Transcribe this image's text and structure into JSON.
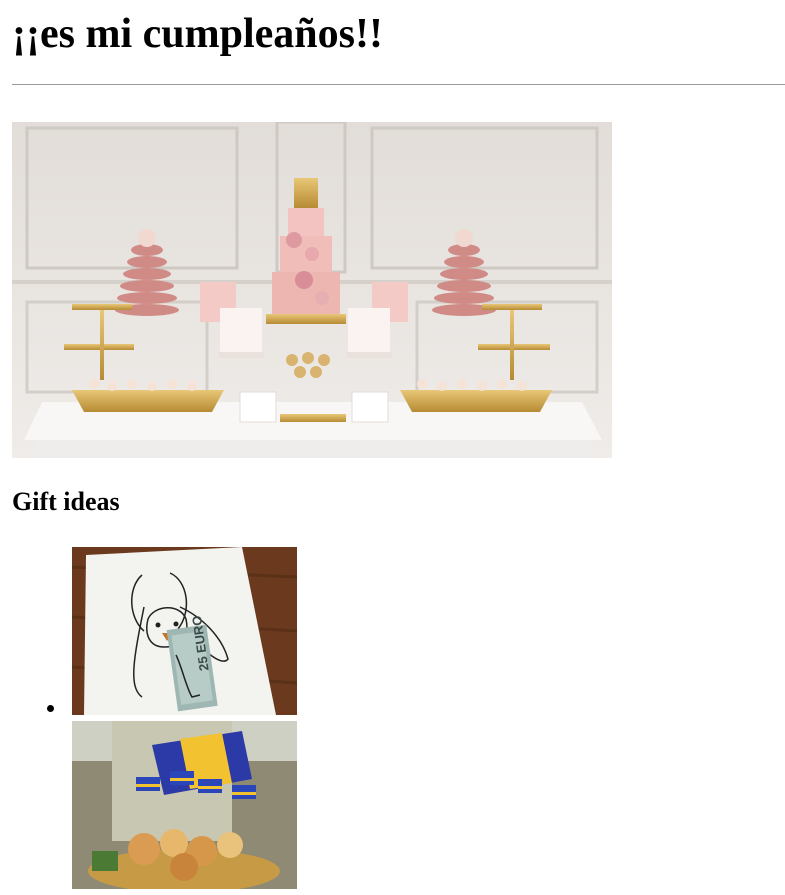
{
  "page": {
    "title": "¡¡es mi cumpleaños!!",
    "gifts_heading": "Gift ideas"
  },
  "hero_image": {
    "alt": ""
  },
  "gifts": [
    {
      "alt": "",
      "banknote_text": "25 EURO"
    },
    {
      "alt": ""
    }
  ],
  "colors": {
    "heading": "#000000",
    "divider": "#9a9a9a",
    "cake_pink": "#e8b4b0",
    "gold": "#c9a04a"
  }
}
